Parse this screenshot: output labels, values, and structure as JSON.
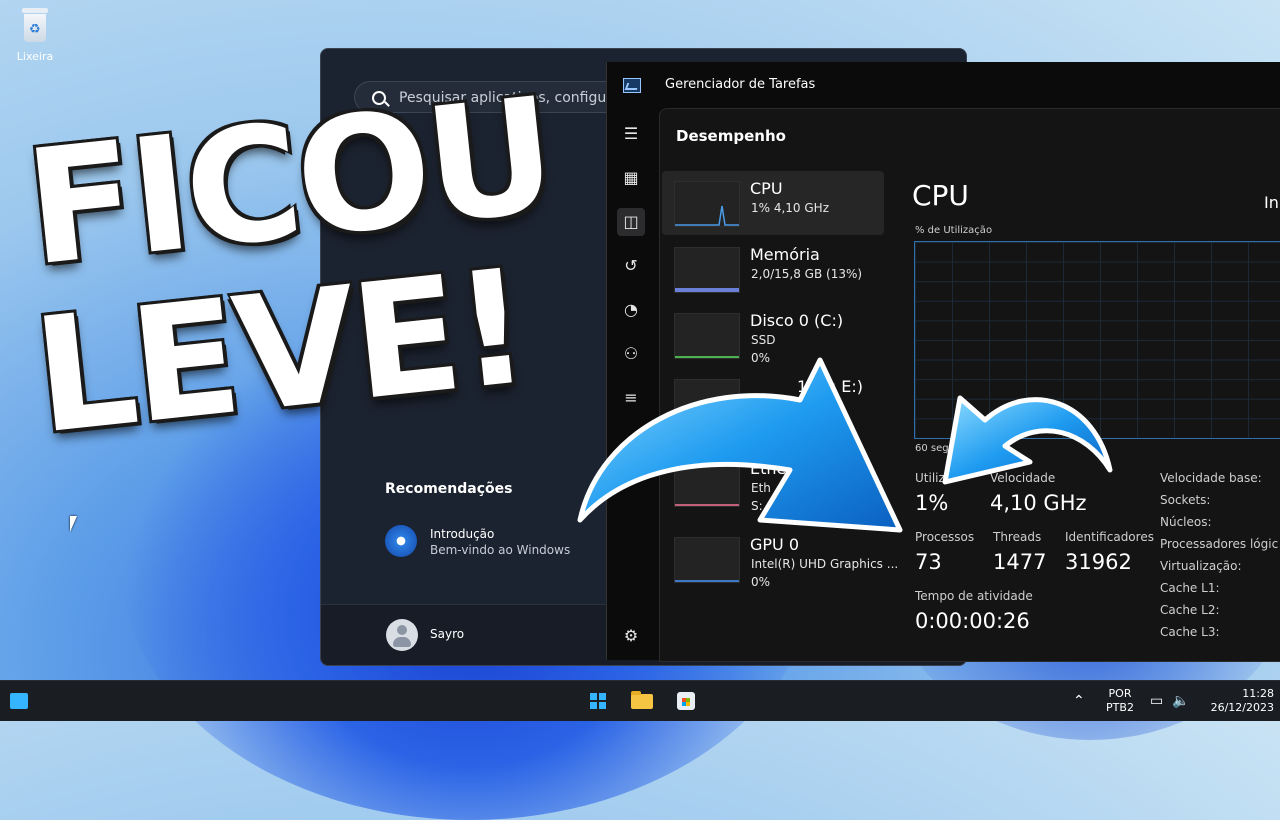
{
  "desktop": {
    "recycle_bin_label": "Lixeira"
  },
  "overlay": {
    "line1": "FICOU",
    "line2": "LEVE!"
  },
  "start_menu": {
    "search_placeholder": "Pesquisar aplicativos, configurações",
    "recommendations_title": "Recomendações",
    "recommendation": {
      "title": "Introdução",
      "subtitle": "Bem-vindo ao Windows"
    },
    "user_name": "Sayro"
  },
  "task_manager": {
    "title": "Gerenciador de Tarefas",
    "section": "Desempenho",
    "items": [
      {
        "name": "CPU",
        "line1": "1%  4,10 GHz",
        "line2": ""
      },
      {
        "name": "Memória",
        "line1": "2,0/15,8 GB (13%)",
        "line2": ""
      },
      {
        "name": "Disco 0 (C:)",
        "line1": "SSD",
        "line2": "0%"
      },
      {
        "name": "1 (D: E:)",
        "line1": "",
        "line2": ""
      },
      {
        "name": "Ether",
        "line1": "Eth",
        "line2": "S: 0"
      },
      {
        "name": "GPU 0",
        "line1": "Intel(R) UHD Graphics ...",
        "line2": "0%"
      }
    ],
    "detail": {
      "title": "CPU",
      "model_partial": "In",
      "util_label": "% de Utilização",
      "axis_label": "60 seg",
      "utilization_label": "Utiliz",
      "utilization_value": "1%",
      "speed_label": "Velocidade",
      "speed_value": "4,10 GHz",
      "processes_label": "Processos",
      "processes_value": "73",
      "threads_label": "Threads",
      "threads_value": "1477",
      "handles_label": "Identificadores",
      "handles_value": "31962",
      "uptime_label": "Tempo de atividade",
      "uptime_value": "0:00:00:26",
      "specs": [
        "Velocidade base:",
        "Sockets:",
        "Núcleos:",
        "Processadores lógic",
        "Virtualização:",
        "Cache L1:",
        "Cache L2:",
        "Cache L3:"
      ]
    }
  },
  "taskbar": {
    "lang_line1": "POR",
    "lang_line2": "PTB2",
    "time": "11:28",
    "date": "26/12/2023"
  },
  "colors": {
    "arrow_blue": "#1e9bf0",
    "graph_border": "#2f6ea8"
  }
}
